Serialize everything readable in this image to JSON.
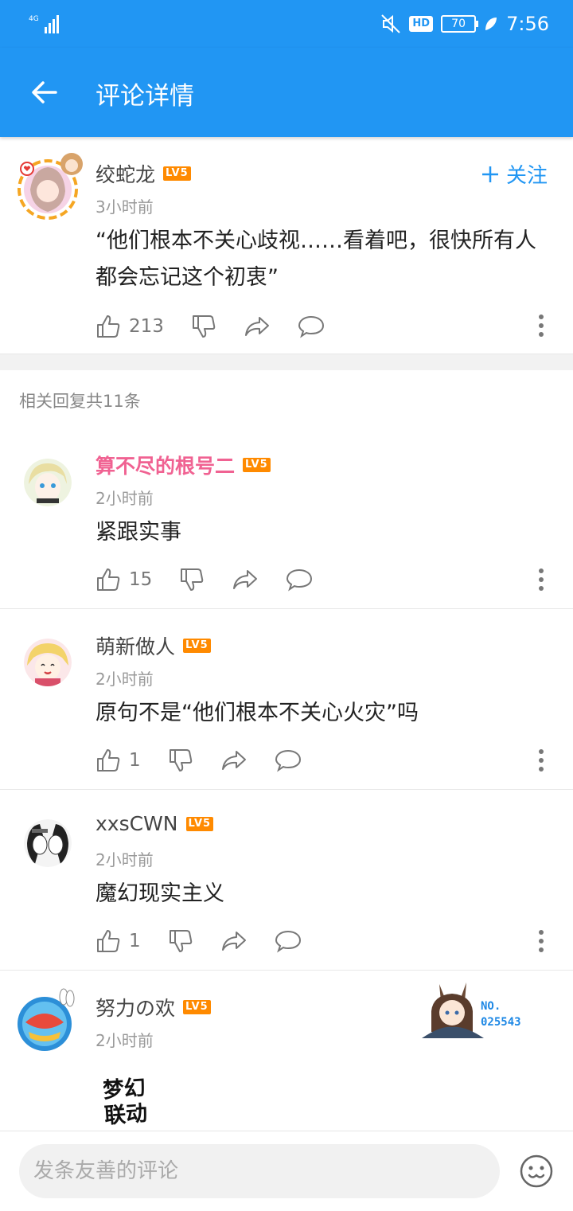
{
  "status": {
    "network": "4G",
    "hd": "HD",
    "battery": "70",
    "time": "7:56"
  },
  "header": {
    "title": "评论详情"
  },
  "main_comment": {
    "username": "绞蛇龙",
    "level": "LV5",
    "time": "3小时前",
    "follow_label": "关注",
    "text": "“他们根本不关心歧视……看着吧，很快所有人都会忘记这个初衷”",
    "likes": "213"
  },
  "replies_header": "相关回复共11条",
  "replies": [
    {
      "username": "算不尽的根号二",
      "level": "LV5",
      "time": "2小时前",
      "text": "紧跟实事",
      "likes": "15"
    },
    {
      "username": "萌新做人",
      "level": "LV5",
      "time": "2小时前",
      "text": "原句不是“他们根本不关心火灾”吗",
      "likes": "1"
    },
    {
      "username": "xxsCWN",
      "level": "LV5",
      "time": "2小时前",
      "text": "魔幻现实主义",
      "likes": "1"
    },
    {
      "username": "努力の欢",
      "level": "LV5",
      "time": "2小时前",
      "badge_no": "NO.",
      "badge_num": "025543",
      "sticker_line1": "梦幻",
      "sticker_line2": "联动"
    }
  ],
  "bottom": {
    "placeholder": "发条友善的评论"
  },
  "colors": {
    "primary": "#2196f3",
    "level": "#ff8a00",
    "vip_name": "#f06292"
  }
}
